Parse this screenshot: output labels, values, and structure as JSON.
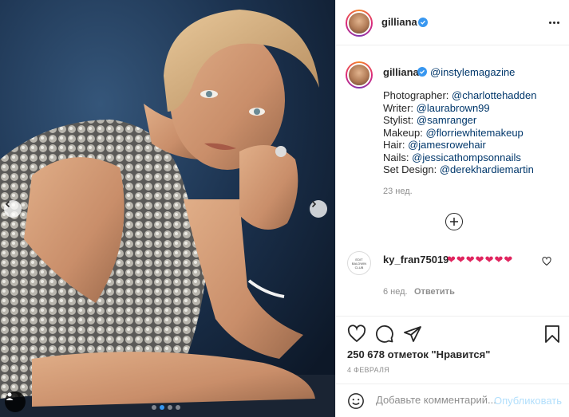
{
  "post": {
    "photo_alt": "",
    "carousel_total": 4,
    "carousel_active": 1
  },
  "header": {
    "username": "gilliana",
    "icons": {
      "verified": "verified-badge-icon",
      "more": "more-options-icon"
    }
  },
  "caption": {
    "username": "gilliana",
    "mention": "@instylemagazine",
    "credits": [
      {
        "label": "Photographer: ",
        "handle": "@charlottehadden"
      },
      {
        "label": "Writer: ",
        "handle": "@laurabrown99"
      },
      {
        "label": "Stylist: ",
        "handle": "@samranger"
      },
      {
        "label": "Makeup: ",
        "handle": "@florriewhitemakeup"
      },
      {
        "label": "Hair: ",
        "handle": "@jamesrowehair"
      },
      {
        "label": "Nails: ",
        "handle": "@jessicathompsonnails"
      },
      {
        "label": "Set Design: ",
        "handle": "@derekhardiemartin"
      }
    ],
    "time": "23 нед."
  },
  "load_more_icon": "plus-circle-icon",
  "comments": [
    {
      "username": "ky_fran75019",
      "text": "❤❤❤❤❤❤❤",
      "time": "6 нед.",
      "reply_label": "Ответить"
    }
  ],
  "actions": {
    "icons": [
      "heart-icon",
      "comment-icon",
      "share-icon",
      "bookmark-icon"
    ],
    "likes_text": "250 678 отметок \"Нравится\"",
    "date": "4 ФЕВРАЛЯ"
  },
  "comment_box": {
    "placeholder": "Добавьте комментарий...",
    "post_label": "Опубликовать"
  },
  "colors": {
    "link": "#00376b",
    "accent": "#3897f0",
    "heart": "#e0245e",
    "muted": "#8e8e8e"
  }
}
